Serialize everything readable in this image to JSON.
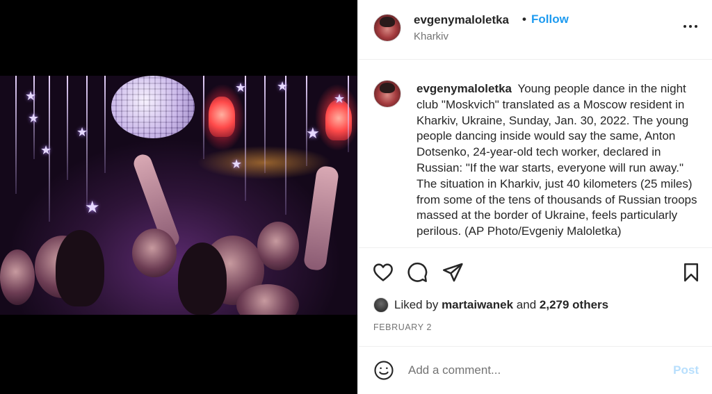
{
  "post": {
    "author": {
      "username": "evgenymaloletka",
      "location": "Kharkiv",
      "follow_label": "Follow",
      "separator": "•"
    },
    "caption": {
      "username": "evgenymaloletka",
      "text": "Young people dance in the night club \"Moskvich\" translated as a Moscow resident in Kharkiv, Ukraine, Sunday, Jan. 30, 2022. The young people dancing inside would say the same, Anton Dotsenko, 24-year-old tech worker, declared in Russian: \"If the war starts, everyone will run away.\" The situation in Kharkiv, just 40 kilometers (25 miles) from some of the tens of thousands of Russian troops massed at the border of Ukraine, feels particularly perilous. (AP Photo/Evgeniy Maloletka)"
    },
    "actions": {
      "like_icon": "heart-icon",
      "comment_icon": "comment-icon",
      "share_icon": "send-icon",
      "save_icon": "bookmark-icon"
    },
    "likes": {
      "prefix": "Liked by",
      "liker": "martaiwanek",
      "conjunction": "and",
      "others": "2,279 others"
    },
    "date": "FEBRUARY 2",
    "comment": {
      "placeholder": "Add a comment...",
      "post_label": "Post",
      "emoji_icon": "smiley-icon"
    },
    "more_icon": "more-options-icon"
  },
  "colors": {
    "follow": "#1e9bf0",
    "post_disabled": "#b8dffd",
    "text": "#262626",
    "secondary": "#737373",
    "divider": "#efefef"
  }
}
